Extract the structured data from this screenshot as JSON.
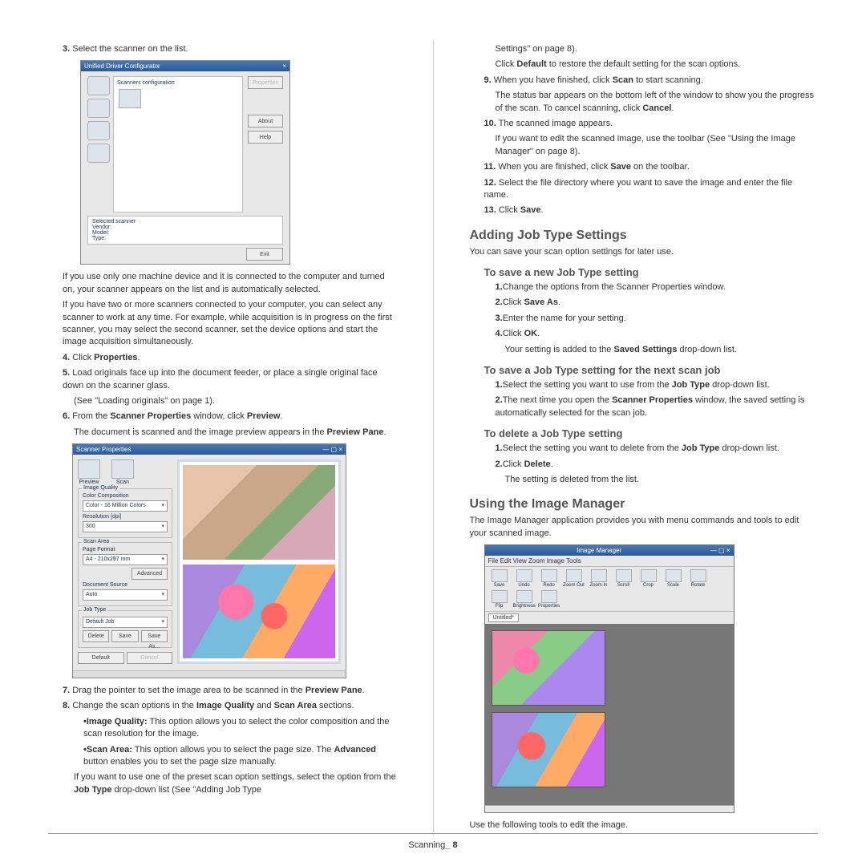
{
  "footer": {
    "label": "Scanning",
    "sep": "_",
    "page": "8"
  },
  "left": {
    "s3": {
      "num": "3.",
      "text": "Select the scanner on the list."
    },
    "fig1": {
      "title": "Unified Driver Configurator",
      "close": "×",
      "sccfg": "Scanners configuration",
      "btnProp": "Properties",
      "btnAbout": "About",
      "btnHelp": "Help",
      "selHdr": "Selected scanner",
      "vendor": "Vendor:",
      "model": "Model:",
      "type": "Type:",
      "exit": "Exit"
    },
    "p1": "If you use only one machine device and it is connected to the computer and turned on, your scanner appears on the list and is automatically selected.",
    "p2": "If you have two or more scanners connected to your computer, you can select any scanner to work at any time. For example, while acquisition is in progress on the first scanner, you may select the second scanner, set the device options and start the image acquisition simultaneously.",
    "s4": {
      "num": "4.",
      "a": "Click ",
      "b": "Properties",
      "c": "."
    },
    "s5": {
      "num": "5.",
      "text": "Load originals face up into the document feeder, or place a single original face down on the scanner glass.",
      "see": "(See \"Loading originals\" on page 1)."
    },
    "s6": {
      "num": "6.",
      "a": "From the ",
      "b": "Scanner Properties",
      "c": " window, click ",
      "d": "Preview",
      "e": ".",
      "f": "The document is scanned and the image preview appears in the ",
      "g": "Preview Pane",
      "h": "."
    },
    "fig2": {
      "title": "Scanner Properties",
      "wbtns": "— ▢ ×",
      "tabPrev": "Preview",
      "tabScan": "Scan",
      "gIQ": "Image Quality",
      "cc": "Color Composition",
      "ccv": "Color - 16 Million Colors",
      "res": "Resolution [dpi]",
      "resv": "300",
      "gSA": "Scan Area",
      "pf": "Page Format",
      "pfv": "A4 - 210x297 mm",
      "adv": "Advanced",
      "ds": "Document Source",
      "dsv": "Auto",
      "gJT": "Job Type",
      "jtv": "Default Job",
      "del": "Delete",
      "save": "Save",
      "saveas": "Save As...",
      "def": "Default",
      "cancel": "Cancel"
    },
    "s7": {
      "num": "7.",
      "a": "Drag the pointer to set the image area to be scanned in the ",
      "b": "Preview Pane",
      "c": "."
    },
    "s8": {
      "num": "8.",
      "a": "Change the scan options in the ",
      "b": "Image Quality",
      "c": " and ",
      "d": "Scan Area",
      "e": " sections.",
      "iq": {
        "label": "•Image Quality:",
        "text": "  This option allows you to select the color composition and the scan resolution for the image."
      },
      "sa": {
        "label": "•Scan Area:",
        "text": "  This option allows you to select the page size. The ",
        "b": "Advanced",
        "t2": " button enables you to set the page size manually."
      },
      "tail": {
        "a": "If you want to use one of the preset scan option settings, select the option from the ",
        "b": "Job Type",
        "c": " drop-down list (See \"Adding Job Type"
      }
    }
  },
  "right": {
    "cont8": "Settings\" on page 8).",
    "cont8b": {
      "a": "Click ",
      "b": "Default",
      "c": " to restore the default setting for the scan options."
    },
    "s9": {
      "num": "9.",
      "a": "When you have finished, click ",
      "b": "Scan",
      "c": " to start scanning.",
      "d": "The status bar appears on the bottom left of the window to show you the progress of the scan. To cancel scanning, click ",
      "e": "Cancel",
      "f": "."
    },
    "s10": {
      "num": "10.",
      "a": "The scanned image appears.",
      "b": "If you want to edit the scanned image, use the toolbar (See \"Using the Image Manager\" on page 8)."
    },
    "s11": {
      "num": "11.",
      "a": "When you are finished, click ",
      "b": "Save",
      "c": " on the toolbar."
    },
    "s12": {
      "num": "12.",
      "a": "Select the file directory where you want to save the image and enter the file name."
    },
    "s13": {
      "num": "13.",
      "a": "Click ",
      "b": "Save",
      "c": "."
    },
    "h2a": "Adding Job Type Settings",
    "h2at": "You can save your scan option settings for later use.",
    "h3a": "To save a new Job Type setting",
    "a1": {
      "n": "1.",
      "t": "Change the options from the Scanner Properties window."
    },
    "a2": {
      "n": "2.",
      "a": "Click ",
      "b": "Save As",
      "c": "."
    },
    "a3": {
      "n": "3.",
      "t": "Enter the name for your setting."
    },
    "a4": {
      "n": "4.",
      "a": "Click ",
      "b": "OK",
      "c": ".",
      "d": "Your setting is added to the ",
      "e": "Saved Settings",
      "f": " drop-down list."
    },
    "h3b": "To save a Job Type setting for the next scan job",
    "b1": {
      "n": "1.",
      "a": "Select the setting you want to use from the ",
      "b": "Job Type",
      "c": " drop-down list."
    },
    "b2": {
      "n": "2.",
      "a": "The next time you open the ",
      "b": "Scanner Properties",
      "c": " window, the saved setting is automatically selected for the scan job."
    },
    "h3c": "To delete a Job Type setting",
    "c1": {
      "n": "1.",
      "a": "Select the setting you want to delete from the ",
      "b": "Job Type",
      "c": " drop-down list."
    },
    "c2": {
      "n": "2.",
      "a": "Click ",
      "b": "Delete",
      "c": ".",
      "d": "The setting is deleted from the list."
    },
    "h2b": "Using the Image Manager",
    "h2bt": "The Image Manager application provides you with menu commands and tools to edit your scanned image.",
    "fig3": {
      "title": "Image Manager",
      "wbtns": "— ▢ ×",
      "menu": "File   Edit   View   Zoom   Image   Tools",
      "tools": [
        "Save",
        "Undo",
        "Redo",
        "Zoom Out",
        "Zoom In",
        "Scroll",
        "Crop",
        "Scale",
        "Rotate",
        "Flip",
        "Brightness",
        "Properties"
      ],
      "tab": "Untitled*"
    },
    "tail": "Use the following tools to edit the image."
  }
}
